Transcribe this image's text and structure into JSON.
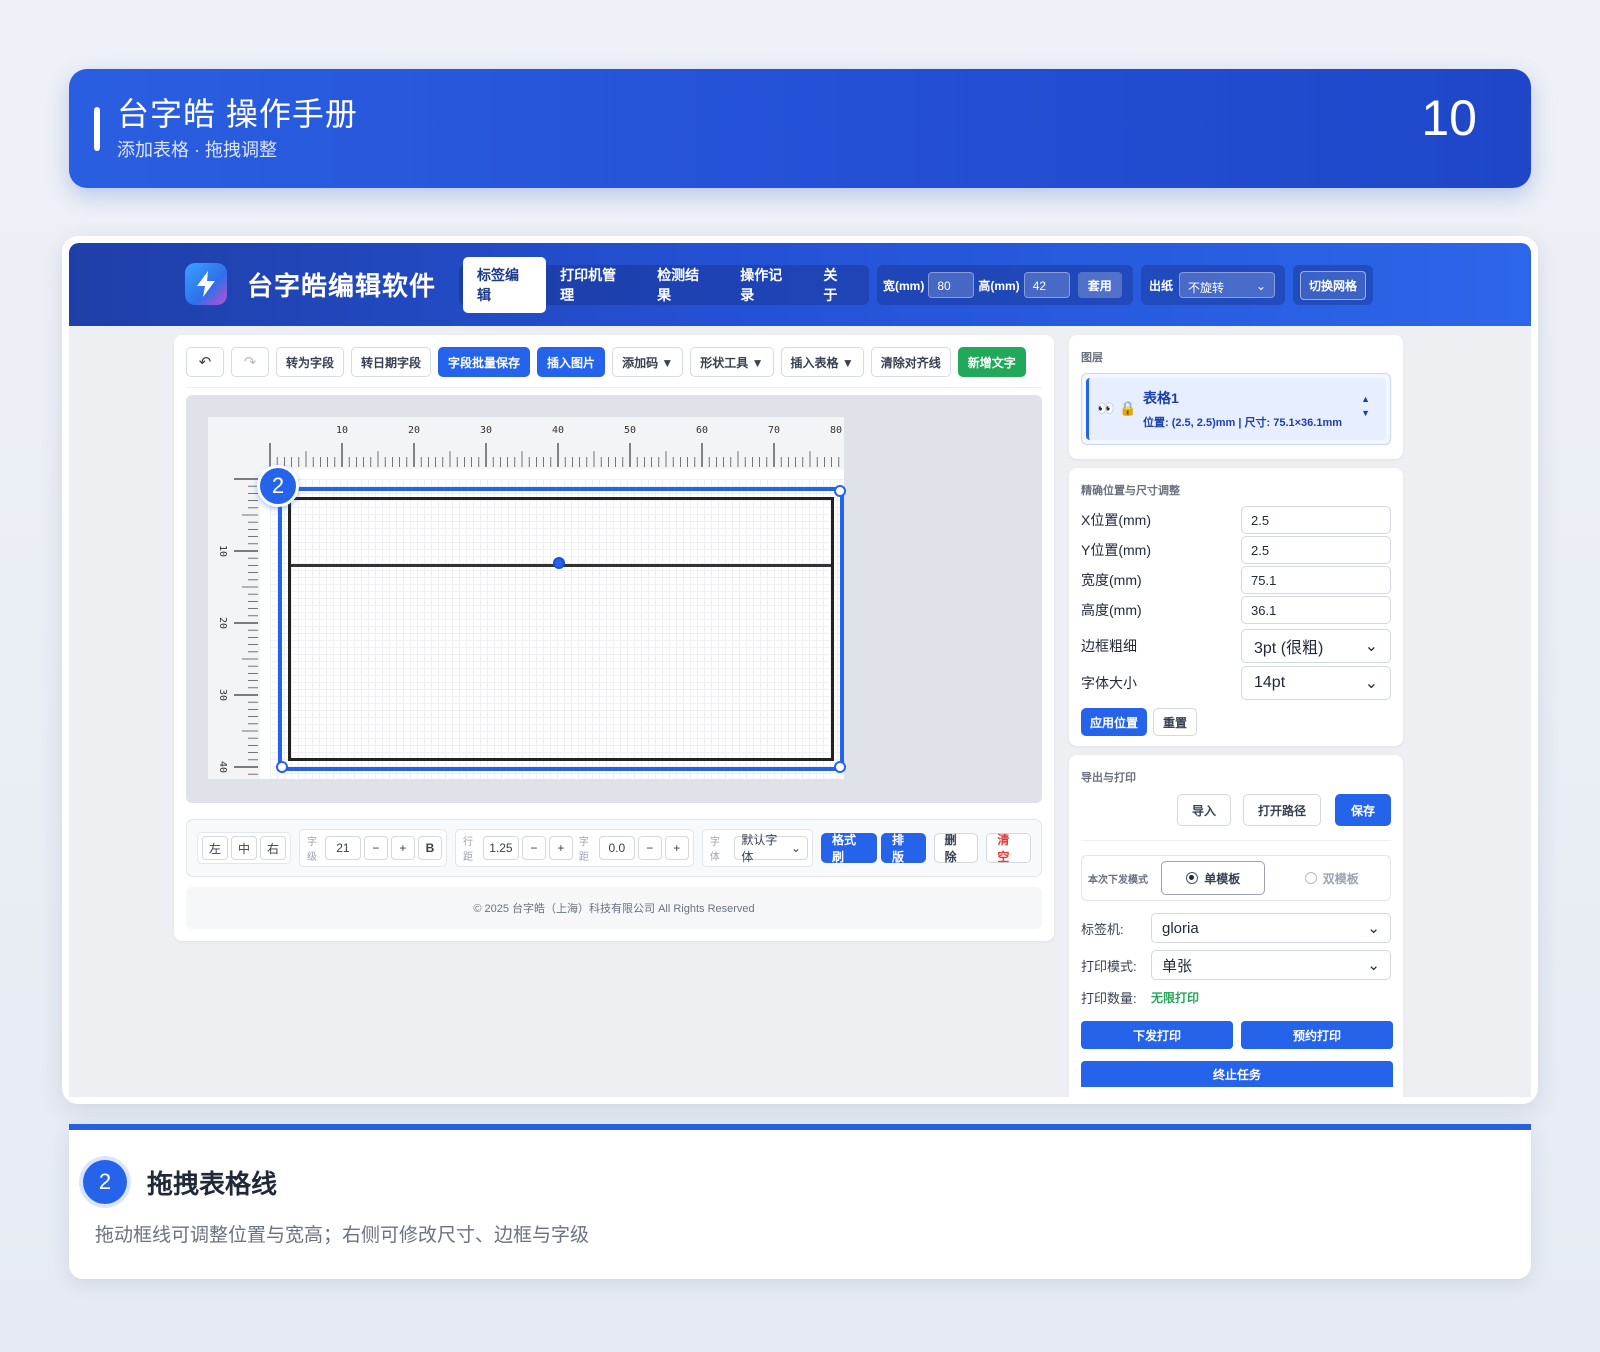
{
  "banner": {
    "title": "台字皓 操作手册",
    "subtitle": "添加表格 · 拖拽调整",
    "page_number": "10"
  },
  "app": {
    "title": "台字皓编辑软件",
    "nav_tabs": [
      "标签编辑",
      "打印机管理",
      "检测结果",
      "操作记录",
      "关于"
    ],
    "active_tab": "标签编辑",
    "width_label": "宽(mm)",
    "width_value": "80",
    "height_label": "高(mm)",
    "height_value": "42",
    "apply_size_label": "套用",
    "paper_out_label": "出纸",
    "paper_rotation": "不旋转",
    "toggle_grid_label": "切换网格"
  },
  "toolbar": {
    "to_field": "转为字段",
    "to_date_field": "转日期字段",
    "batch_save_fields": "字段批量保存",
    "insert_image": "插入图片",
    "add_code": "添加码 ▼",
    "shape_tool": "形状工具 ▼",
    "insert_table": "插入表格 ▼",
    "clear_guides": "清除对齐线",
    "add_text": "新增文字"
  },
  "rulers": {
    "h_labels": [
      "10",
      "20",
      "30",
      "40",
      "50",
      "60",
      "70",
      "80"
    ],
    "v_labels": [
      "10",
      "20",
      "30",
      "40"
    ]
  },
  "step_badge": "2",
  "format_bar": {
    "align_left": "左",
    "align_center": "中",
    "align_right": "右",
    "size_label": "字级",
    "size_value": "21",
    "minus": "−",
    "plus": "+",
    "bold": "B",
    "line_height_label": "行距",
    "line_height_value": "1.25",
    "letter_spacing_label": "字距",
    "letter_spacing_value": "0.0",
    "font_label": "字体",
    "font_value": "默认字体",
    "format_painter": "格式刷",
    "layout": "排版",
    "delete": "删除",
    "clear": "清空"
  },
  "footer": {
    "copyright": "© 2025 台字皓（上海）科技有限公司 All Rights Reserved"
  },
  "layers": {
    "header": "图层",
    "item_name": "表格1",
    "item_meta": "位置: (2.5, 2.5)mm | 尺寸: 75.1×36.1mm"
  },
  "precise": {
    "header": "精确位置与尺寸调整",
    "x_label": "X位置(mm)",
    "x_value": "2.5",
    "y_label": "Y位置(mm)",
    "y_value": "2.5",
    "w_label": "宽度(mm)",
    "w_value": "75.1",
    "h_label": "高度(mm)",
    "h_value": "36.1",
    "border_label": "边框粗细",
    "border_value": "3pt (很粗)",
    "font_size_label": "字体大小",
    "font_size_value": "14pt",
    "apply_label": "应用位置",
    "reset_label": "重置"
  },
  "export": {
    "header": "导出与打印",
    "import_label": "导入",
    "open_path_label": "打开路径",
    "save_label": "保存",
    "mode_label": "本次下发模式",
    "single_label": "单模板",
    "double_label": "双模板",
    "printer_label": "标签机:",
    "printer_value": "gloria",
    "print_mode_label": "打印模式:",
    "print_mode_value": "单张",
    "qty_label": "打印数量:",
    "qty_value": "无限打印",
    "send_print": "下发打印",
    "schedule_print": "预约打印",
    "stop_task": "终止任务"
  },
  "caption": {
    "number": "2",
    "title": "拖拽表格线",
    "description": "拖动框线可调整位置与宽高；右侧可修改尺寸、边框与字级"
  },
  "colors": {
    "primary": "#2563eb",
    "accent_green": "#22a85a",
    "danger": "#e23b3b"
  }
}
